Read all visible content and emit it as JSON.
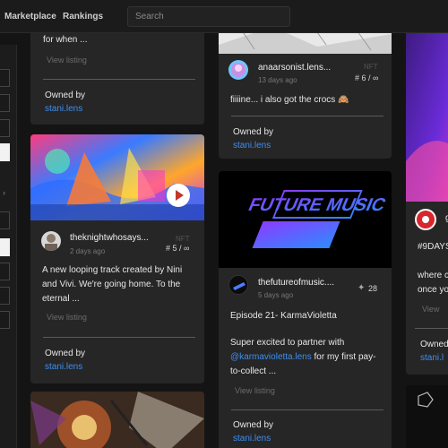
{
  "nav": {
    "marketplace": "Marketplace",
    "rankings": "Rankings"
  },
  "search": {
    "placeholder": "Search"
  },
  "card_a": {
    "desc_tail": "for when ...",
    "view": "View listing",
    "owned_label": "Owned by",
    "owner": "stani.lens"
  },
  "card_b": {
    "author": "theknightwhosays...",
    "time": "2 days ago",
    "badge": "NFT",
    "edition": "# 5 / ∞",
    "desc": "A new looping track created by Nini and Vivi. We're going home. To the eternal ...",
    "view": "View listing",
    "owned_label": "Owned by",
    "owner": "stani.lens"
  },
  "card_c": {
    "author": "anaarsonist.lens...",
    "time": "13 days ago",
    "badge": "NFT",
    "edition": "# 6 / ∞",
    "desc": "fiiiine... i also got the crocs 🙈",
    "owned_label": "Owned by",
    "owner": "stani.lens"
  },
  "card_d": {
    "art_text": "FUTURE MUSIC",
    "author": "thefutureofmusic....",
    "time": "5 days ago",
    "count": "28",
    "title": "Episode 21- KarmaVioletta",
    "desc_pre": "Super excited to partner with ",
    "desc_link": "@karmavioletta.lens",
    "desc_post": " for my first pay-to-collect ...",
    "view": "View listing",
    "owned_label": "Owned by",
    "owner": "stani.lens"
  },
  "card_e": {
    "name_fragment": "g",
    "tag": "#9DAYS",
    "desc": "where c once yo",
    "view": "View",
    "owned_label": "Owned",
    "owner": "stani.l"
  },
  "colors": {
    "accent_link": "#3d8ef0",
    "card_bg": "#262626",
    "page_bg": "#141414"
  },
  "icons": {
    "play": "play-icon",
    "sparkle": "sparkle-icon",
    "chevron": "chevron-right-icon"
  }
}
